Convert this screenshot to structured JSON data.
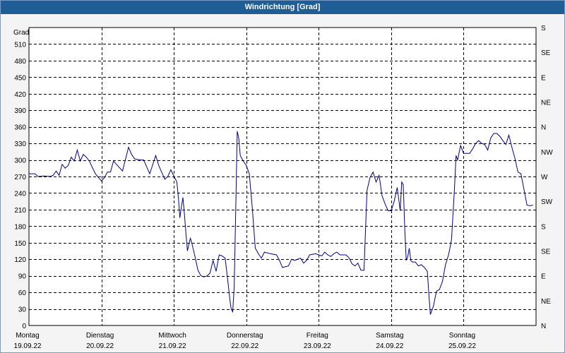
{
  "window": {
    "title": "Windrichtung [Grad]"
  },
  "chart_data": {
    "type": "line",
    "title": "Windrichtung [Grad]",
    "ylabel": "Grad",
    "ylim": [
      0,
      540
    ],
    "y_ticks": [
      0,
      30,
      60,
      90,
      120,
      150,
      180,
      210,
      240,
      270,
      300,
      330,
      360,
      390,
      420,
      450,
      480,
      510
    ],
    "right_axis_labels": [
      "N",
      "NE",
      "E",
      "SE",
      "S",
      "SW",
      "W",
      "NW",
      "N",
      "NE",
      "E",
      "SE",
      "S"
    ],
    "x_axis_days": [
      {
        "day": "Montag",
        "date": "19.09.22"
      },
      {
        "day": "Dienstag",
        "date": "20.09.22"
      },
      {
        "day": "Mittwoch",
        "date": "21.09.22"
      },
      {
        "day": "Donnerstag",
        "date": "22.09.22"
      },
      {
        "day": "Freitag",
        "date": "23.09.22"
      },
      {
        "day": "Samstag",
        "date": "24.09.22"
      },
      {
        "day": "Sonntag",
        "date": "25.09.22"
      }
    ],
    "grid": true,
    "line_color": "#00008b",
    "series": [
      {
        "x_unit": "hours since Montag 19.09.22 00:00",
        "points": [
          [
            0,
            275
          ],
          [
            2,
            275
          ],
          [
            3,
            270
          ],
          [
            5,
            271
          ],
          [
            7,
            270
          ],
          [
            8,
            272
          ],
          [
            9,
            280
          ],
          [
            10,
            272
          ],
          [
            11,
            292
          ],
          [
            12,
            285
          ],
          [
            13,
            290
          ],
          [
            14,
            305
          ],
          [
            15,
            298
          ],
          [
            16,
            318
          ],
          [
            17,
            298
          ],
          [
            18,
            310
          ],
          [
            19,
            305
          ],
          [
            20,
            298
          ],
          [
            22,
            275
          ],
          [
            24,
            262
          ],
          [
            25,
            268
          ],
          [
            26,
            278
          ],
          [
            27,
            278
          ],
          [
            28,
            298
          ],
          [
            29,
            292
          ],
          [
            31,
            280
          ],
          [
            33,
            323
          ],
          [
            34,
            310
          ],
          [
            35,
            302
          ],
          [
            37,
            300
          ],
          [
            38,
            300
          ],
          [
            40,
            275
          ],
          [
            42,
            308
          ],
          [
            43,
            290
          ],
          [
            45,
            265
          ],
          [
            46,
            270
          ],
          [
            47,
            282
          ],
          [
            49,
            260
          ],
          [
            49.5,
            232
          ],
          [
            50,
            195
          ],
          [
            50.5,
            215
          ],
          [
            51,
            232
          ],
          [
            51.5,
            202
          ],
          [
            52,
            168
          ],
          [
            52.5,
            135
          ],
          [
            53,
            148
          ],
          [
            53.5,
            158
          ],
          [
            54,
            148
          ],
          [
            55,
            125
          ],
          [
            56,
            100
          ],
          [
            57,
            90
          ],
          [
            58,
            88
          ],
          [
            59,
            90
          ],
          [
            60,
            95
          ],
          [
            61,
            118
          ],
          [
            62,
            98
          ],
          [
            63,
            128
          ],
          [
            64,
            126
          ],
          [
            65,
            122
          ],
          [
            66,
            75
          ],
          [
            66.5,
            50
          ],
          [
            67,
            30
          ],
          [
            67.5,
            25
          ],
          [
            68,
            70
          ],
          [
            68.5,
            210
          ],
          [
            69,
            352
          ],
          [
            69.5,
            340
          ],
          [
            70,
            308
          ],
          [
            71,
            298
          ],
          [
            72,
            290
          ],
          [
            73,
            275
          ],
          [
            74,
            212
          ],
          [
            75,
            140
          ],
          [
            76,
            130
          ],
          [
            77,
            122
          ],
          [
            78,
            133
          ],
          [
            80,
            130
          ],
          [
            82,
            128
          ],
          [
            83,
            118
          ],
          [
            84,
            105
          ],
          [
            86,
            108
          ],
          [
            87,
            120
          ],
          [
            88,
            118
          ],
          [
            90,
            122
          ],
          [
            91,
            113
          ],
          [
            92,
            118
          ],
          [
            93,
            128
          ],
          [
            95,
            130
          ],
          [
            97,
            126
          ],
          [
            98,
            133
          ],
          [
            99,
            128
          ],
          [
            100,
            125
          ],
          [
            101,
            130
          ],
          [
            102,
            133
          ],
          [
            103,
            128
          ],
          [
            105,
            128
          ],
          [
            106,
            123
          ],
          [
            107,
            112
          ],
          [
            108,
            108
          ],
          [
            109,
            113
          ],
          [
            110,
            100
          ],
          [
            111,
            100
          ],
          [
            112,
            245
          ],
          [
            113,
            268
          ],
          [
            114,
            278
          ],
          [
            115,
            260
          ],
          [
            116,
            272
          ],
          [
            117,
            235
          ],
          [
            118,
            220
          ],
          [
            119,
            208
          ],
          [
            120,
            208
          ],
          [
            121,
            225
          ],
          [
            122,
            250
          ],
          [
            123,
            208
          ],
          [
            123.5,
            260
          ],
          [
            124,
            255
          ],
          [
            124.5,
            175
          ],
          [
            125,
            118
          ],
          [
            125.5,
            125
          ],
          [
            126,
            140
          ],
          [
            126.5,
            118
          ],
          [
            127,
            115
          ],
          [
            128,
            115
          ],
          [
            129,
            108
          ],
          [
            130,
            110
          ],
          [
            131,
            105
          ],
          [
            132,
            98
          ],
          [
            132.5,
            55
          ],
          [
            133,
            20
          ],
          [
            134,
            35
          ],
          [
            135,
            62
          ],
          [
            136,
            65
          ],
          [
            137,
            80
          ],
          [
            138,
            110
          ],
          [
            139,
            128
          ],
          [
            140,
            155
          ],
          [
            141,
            250
          ],
          [
            141.5,
            308
          ],
          [
            142,
            300
          ],
          [
            143,
            326
          ],
          [
            144,
            312
          ],
          [
            146,
            312
          ],
          [
            147,
            320
          ],
          [
            148,
            330
          ],
          [
            149,
            335
          ],
          [
            150,
            330
          ],
          [
            151,
            328
          ],
          [
            152,
            318
          ],
          [
            153,
            340
          ],
          [
            154,
            348
          ],
          [
            155,
            348
          ],
          [
            156,
            343
          ],
          [
            157,
            335
          ],
          [
            158,
            328
          ],
          [
            159,
            345
          ],
          [
            160,
            323
          ],
          [
            161,
            303
          ],
          [
            162,
            278
          ],
          [
            163,
            275
          ],
          [
            165,
            218
          ],
          [
            166,
            217
          ],
          [
            167,
            218
          ]
        ]
      }
    ]
  }
}
